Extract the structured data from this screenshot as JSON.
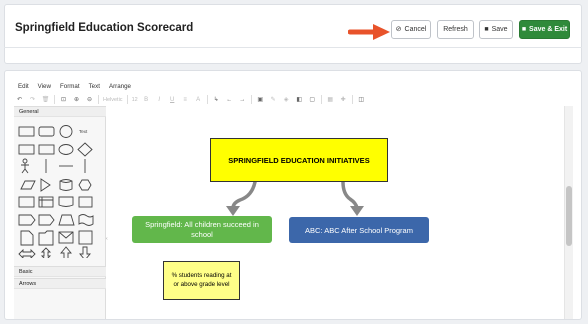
{
  "header": {
    "title": "Springfield Education Scorecard",
    "buttons": {
      "cancel": "Cancel",
      "refresh": "Refresh",
      "save": "Save",
      "save_exit": "Save & Exit"
    },
    "save_exit_color": "#2f8a3a",
    "annotation_arrow_color": "#e8532b"
  },
  "editor": {
    "menu": [
      "Edit",
      "View",
      "Format",
      "Text",
      "Arrange"
    ],
    "toolbar": {
      "zoom_label": "Helvetic",
      "font_size": "12",
      "icons": [
        "undo-icon",
        "redo-icon",
        "delete-icon",
        "fit-icon",
        "zoom-in-icon",
        "zoom-out-icon",
        "bold-icon",
        "italic-icon",
        "underline-icon",
        "align-icon",
        "font-color-icon",
        "waypoint-icon",
        "arrow-left-icon",
        "arrow-right-icon",
        "image-icon",
        "line-color-icon",
        "fill-color-icon",
        "gradient-icon",
        "shadow-icon",
        "table-icon",
        "plus-icon",
        "panel-icon"
      ]
    },
    "sidebar": {
      "sections": [
        "General",
        "Basic",
        "Arrows"
      ]
    }
  },
  "diagram": {
    "nodes": {
      "main": "SPRINGFIELD EDUCATION INITIATIVES",
      "springfield": "Springfield: All children succeed in school",
      "abc": "ABC: ABC After School Program",
      "students": "% students reading at or above grade level"
    },
    "colors": {
      "main": "#ffff00",
      "springfield": "#62b74b",
      "abc": "#3c67aa",
      "students": "#ffff88"
    }
  }
}
